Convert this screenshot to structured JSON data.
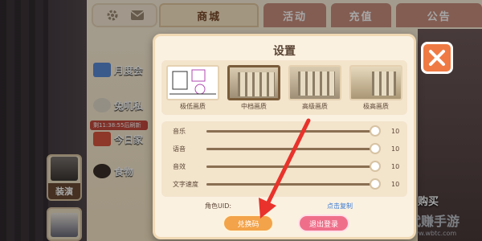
{
  "tabs": [
    {
      "label": "商城"
    },
    {
      "label": "活动"
    },
    {
      "label": "充值"
    },
    {
      "label": "公告"
    }
  ],
  "side_menu": [
    {
      "label": "月度会"
    },
    {
      "label": "兔叽私"
    },
    {
      "label": "今日家"
    },
    {
      "label": "食物"
    }
  ],
  "timer_badge": "剩11:38:55后刷新",
  "side_cards": [
    {
      "label": "装演"
    }
  ],
  "buy_label": "购买",
  "watermark": {
    "line1": "代赚手游",
    "line2": "www.wbtc.com"
  },
  "settings": {
    "title": "设置",
    "quality_options": [
      {
        "label": "极低画质",
        "selected": false
      },
      {
        "label": "中档画质",
        "selected": true
      },
      {
        "label": "高级画质",
        "selected": false
      },
      {
        "label": "极高画质",
        "selected": false
      }
    ],
    "sliders": [
      {
        "name": "音乐",
        "value": 10,
        "max": 10
      },
      {
        "name": "语音",
        "value": 10,
        "max": 10
      },
      {
        "name": "音效",
        "value": 10,
        "max": 10
      },
      {
        "name": "文字速度",
        "value": 10,
        "max": 10
      }
    ],
    "uid_label": "角色UID:",
    "copy_link": "点击复制",
    "redeem_button": "兑换码",
    "logout_button": "退出登录"
  },
  "colors": {
    "accent_orange": "#f07a43",
    "redeem": "#f3a34a",
    "logout": "#ef6f8a",
    "annotation_arrow": "#e8322b"
  }
}
